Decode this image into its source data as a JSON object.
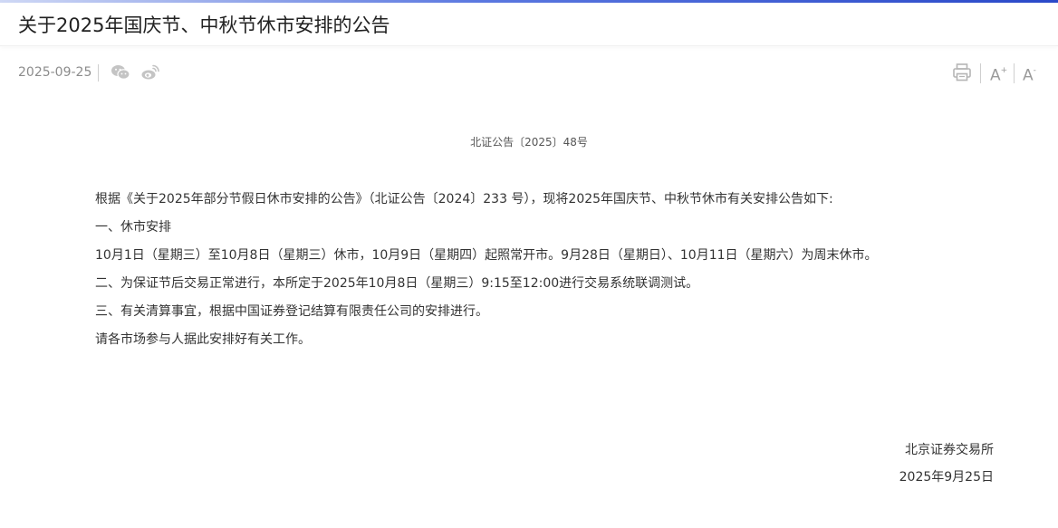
{
  "article": {
    "title": "关于2025年国庆节、中秋节休市安排的公告",
    "date": "2025-09-25",
    "doc_number": "北证公告〔2025〕48号",
    "paragraphs": [
      "根据《关于2025年部分节假日休市安排的公告》（北证公告〔2024〕233 号），现将2025年国庆节、中秋节休市有关安排公告如下:",
      "一、休市安排",
      "10月1日（星期三）至10月8日（星期三）休市，10月9日（星期四）起照常开市。9月28日（星期日）、10月11日（星期六）为周末休市。",
      "二、为保证节后交易正常进行，本所定于2025年10月8日（星期三）9:15至12:00进行交易系统联调测试。",
      "三、有关清算事宜，根据中国证券登记结算有限责任公司的安排进行。",
      "请各市场参与人据此安排好有关工作。"
    ],
    "signature": {
      "org": "北京证券交易所",
      "date": "2025年9月25日"
    }
  },
  "toolbar": {
    "share_icons": [
      "wechat-icon",
      "weibo-icon"
    ],
    "print_icon": "printer-icon",
    "font_increase_label": "A",
    "font_increase_sup": "+",
    "font_decrease_label": "A",
    "font_decrease_sup": "-"
  },
  "colors": {
    "accent": "#2a49c9",
    "muted_icon": "#b8b8b8",
    "text": "#333333"
  }
}
